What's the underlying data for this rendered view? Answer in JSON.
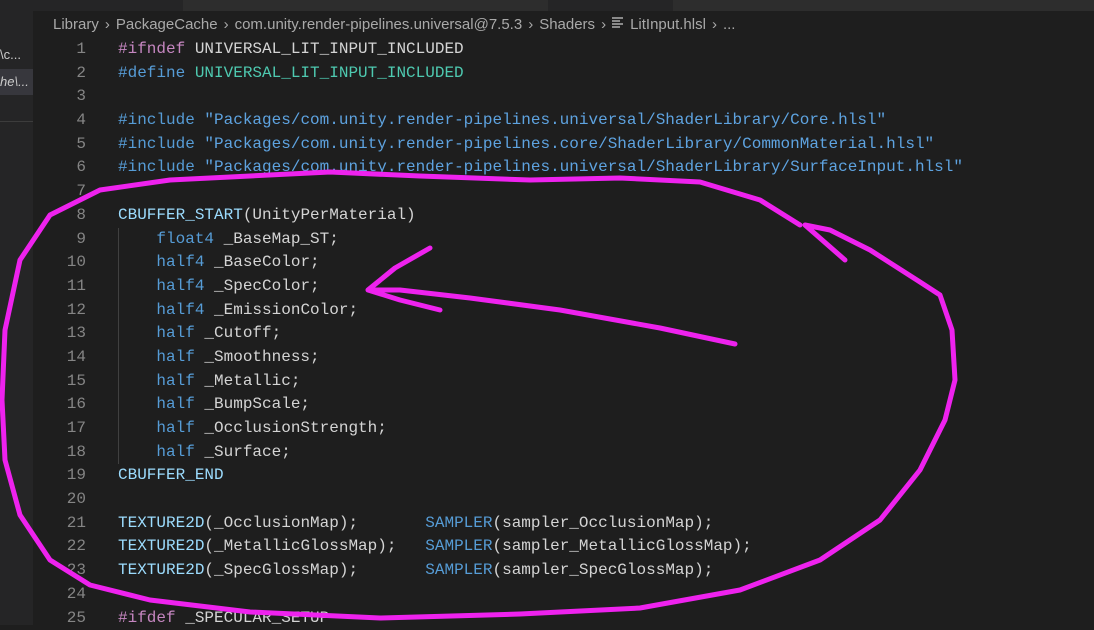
{
  "sidebar": {
    "items": [
      {
        "label": "\\c..."
      },
      {
        "label": "he\\..."
      }
    ]
  },
  "breadcrumb": [
    "Library",
    "PackageCache",
    "com.unity.render-pipelines.universal@7.5.3",
    "Shaders",
    "LitInput.hlsl",
    "..."
  ],
  "colors": {
    "annotation": "#ee22ee",
    "background": "#1e1e1e"
  },
  "lines": [
    {
      "n": "1",
      "t": [
        [
          "kw",
          "#ifndef "
        ],
        [
          "plain",
          "UNIVERSAL_LIT_INPUT_INCLUDED"
        ]
      ]
    },
    {
      "n": "2",
      "t": [
        [
          "dir",
          "#define "
        ],
        [
          "macro",
          "UNIVERSAL_LIT_INPUT_INCLUDED"
        ]
      ]
    },
    {
      "n": "3",
      "t": []
    },
    {
      "n": "4",
      "t": [
        [
          "dir",
          "#include "
        ],
        [
          "str",
          "\"Packages/com.unity.render-pipelines.universal/ShaderLibrary/Core.hlsl\""
        ]
      ]
    },
    {
      "n": "5",
      "t": [
        [
          "dir",
          "#include "
        ],
        [
          "str",
          "\"Packages/com.unity.render-pipelines.core/ShaderLibrary/CommonMaterial.hlsl\""
        ]
      ]
    },
    {
      "n": "6",
      "t": [
        [
          "dir",
          "#include "
        ],
        [
          "str",
          "\"Packages/com.unity.render-pipelines.universal/ShaderLibrary/SurfaceInput.hlsl\""
        ]
      ]
    },
    {
      "n": "7",
      "t": []
    },
    {
      "n": "8",
      "t": [
        [
          "fn",
          "CBUFFER_START"
        ],
        [
          "plain",
          "(UnityPerMaterial)"
        ]
      ]
    },
    {
      "n": "9",
      "g": 1,
      "t": [
        [
          "plain",
          "    "
        ],
        [
          "type",
          "float4"
        ],
        [
          "plain",
          " _BaseMap_ST;"
        ]
      ]
    },
    {
      "n": "10",
      "g": 1,
      "t": [
        [
          "plain",
          "    "
        ],
        [
          "type",
          "half4"
        ],
        [
          "plain",
          " _BaseColor;"
        ]
      ]
    },
    {
      "n": "11",
      "g": 1,
      "t": [
        [
          "plain",
          "    "
        ],
        [
          "type",
          "half4"
        ],
        [
          "plain",
          " _SpecColor;"
        ]
      ]
    },
    {
      "n": "12",
      "g": 1,
      "t": [
        [
          "plain",
          "    "
        ],
        [
          "type",
          "half4"
        ],
        [
          "plain",
          " _EmissionColor;"
        ]
      ]
    },
    {
      "n": "13",
      "g": 1,
      "t": [
        [
          "plain",
          "    "
        ],
        [
          "type",
          "half"
        ],
        [
          "plain",
          " _Cutoff;"
        ]
      ]
    },
    {
      "n": "14",
      "g": 1,
      "t": [
        [
          "plain",
          "    "
        ],
        [
          "type",
          "half"
        ],
        [
          "plain",
          " _Smoothness;"
        ]
      ]
    },
    {
      "n": "15",
      "g": 1,
      "t": [
        [
          "plain",
          "    "
        ],
        [
          "type",
          "half"
        ],
        [
          "plain",
          " _Metallic;"
        ]
      ]
    },
    {
      "n": "16",
      "g": 1,
      "t": [
        [
          "plain",
          "    "
        ],
        [
          "type",
          "half"
        ],
        [
          "plain",
          " _BumpScale;"
        ]
      ]
    },
    {
      "n": "17",
      "g": 1,
      "t": [
        [
          "plain",
          "    "
        ],
        [
          "type",
          "half"
        ],
        [
          "plain",
          " _OcclusionStrength;"
        ]
      ]
    },
    {
      "n": "18",
      "g": 1,
      "t": [
        [
          "plain",
          "    "
        ],
        [
          "type",
          "half"
        ],
        [
          "plain",
          " _Surface;"
        ]
      ]
    },
    {
      "n": "19",
      "t": [
        [
          "fn",
          "CBUFFER_END"
        ]
      ]
    },
    {
      "n": "20",
      "t": []
    },
    {
      "n": "21",
      "t": [
        [
          "fn",
          "TEXTURE2D"
        ],
        [
          "plain",
          "(_OcclusionMap);       "
        ],
        [
          "type",
          "SAMPLER"
        ],
        [
          "plain",
          "(sampler_OcclusionMap);"
        ]
      ]
    },
    {
      "n": "22",
      "t": [
        [
          "fn",
          "TEXTURE2D"
        ],
        [
          "plain",
          "(_MetallicGlossMap);   "
        ],
        [
          "type",
          "SAMPLER"
        ],
        [
          "plain",
          "(sampler_MetallicGlossMap);"
        ]
      ]
    },
    {
      "n": "23",
      "t": [
        [
          "fn",
          "TEXTURE2D"
        ],
        [
          "plain",
          "(_SpecGlossMap);       "
        ],
        [
          "type",
          "SAMPLER"
        ],
        [
          "plain",
          "(sampler_SpecGlossMap);"
        ]
      ]
    },
    {
      "n": "24",
      "t": []
    },
    {
      "n": "25",
      "t": [
        [
          "kw",
          "#ifdef "
        ],
        [
          "plain",
          "_SPECULAR_SETUP"
        ]
      ]
    }
  ]
}
